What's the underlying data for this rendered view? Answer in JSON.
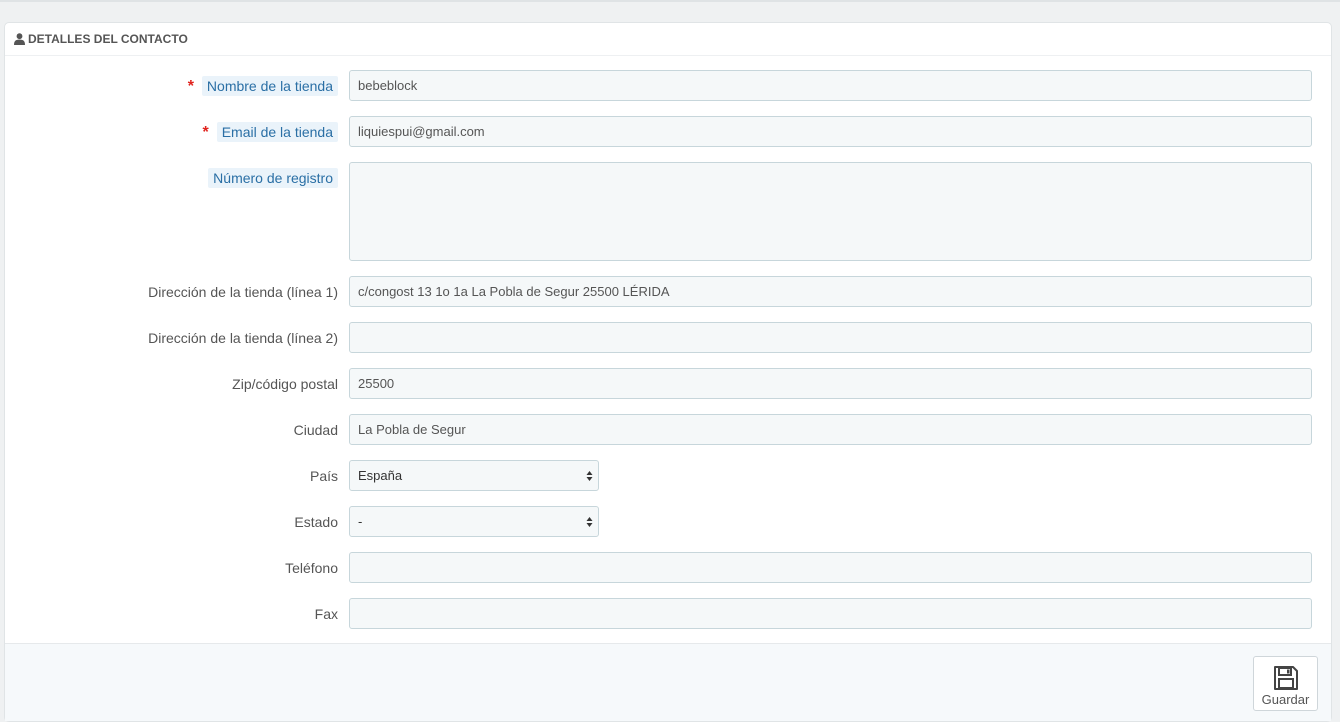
{
  "panel": {
    "title": "DETALLES DEL CONTACTO",
    "icon": "user-icon"
  },
  "fields": {
    "store_name": {
      "label": "Nombre de la tienda",
      "required": true,
      "value": "bebeblock"
    },
    "store_email": {
      "label": "Email de la tienda",
      "required": true,
      "value": "liquiespui@gmail.com"
    },
    "registration_number": {
      "label": "Número de registro",
      "required": false,
      "value": ""
    },
    "address1": {
      "label": "Dirección de la tienda (línea 1)",
      "value": "c/congost 13 1o 1a La Pobla de Segur 25500 LÉRIDA"
    },
    "address2": {
      "label": "Dirección de la tienda (línea 2)",
      "value": ""
    },
    "zip": {
      "label": "Zip/código postal",
      "value": "25500"
    },
    "city": {
      "label": "Ciudad",
      "value": "La Pobla de Segur"
    },
    "country": {
      "label": "País",
      "selected": "España"
    },
    "state": {
      "label": "Estado",
      "selected": "-"
    },
    "phone": {
      "label": "Teléfono",
      "value": ""
    },
    "fax": {
      "label": "Fax",
      "value": ""
    }
  },
  "footer": {
    "save_label": "Guardar",
    "save_icon": "save-icon"
  },
  "colors": {
    "required_star": "#e0231d",
    "hint_label_bg": "#eaf3fa",
    "hint_label_text": "#2a6fa5",
    "input_bg": "#f5f8f9",
    "input_border": "#c7d6db"
  }
}
